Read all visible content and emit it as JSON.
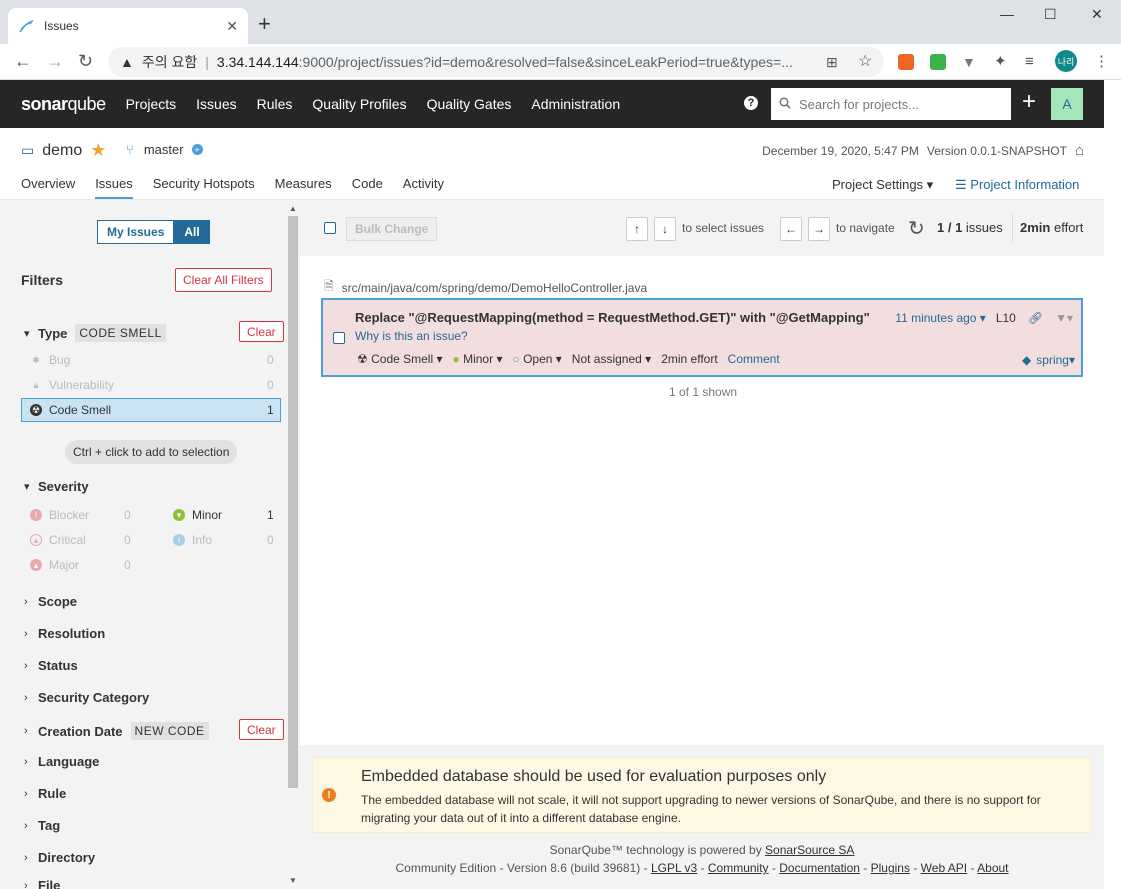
{
  "browser": {
    "tab_title": "Issues",
    "security_label": "주의 요함",
    "url_host": "3.34.144.144",
    "url_path": ":9000/project/issues?id=demo&resolved=false&sinceLeakPeriod=true&types=...",
    "profile_initials": "나리"
  },
  "nav": {
    "logo_bold": "sonar",
    "logo_rest": "qube",
    "links": [
      "Projects",
      "Issues",
      "Rules",
      "Quality Profiles",
      "Quality Gates",
      "Administration"
    ],
    "help": "?",
    "search_placeholder": "Search for projects...",
    "plus": "+",
    "user_initial": "A"
  },
  "project": {
    "name": "demo",
    "branch": "master",
    "date": "December 19, 2020, 5:47 PM",
    "version": "Version 0.0.1-SNAPSHOT",
    "tabs": [
      "Overview",
      "Issues",
      "Security Hotspots",
      "Measures",
      "Code",
      "Activity"
    ],
    "settings": "Project Settings",
    "info": "Project Information"
  },
  "sidebar": {
    "my_issues": "My Issues",
    "all": "All",
    "filters_title": "Filters",
    "clear_all": "Clear All Filters",
    "clear": "Clear",
    "type_label": "Type",
    "type_badge": "CODE SMELL",
    "type_items": [
      {
        "label": "Bug",
        "count": "0"
      },
      {
        "label": "Vulnerability",
        "count": "0"
      },
      {
        "label": "Code Smell",
        "count": "1"
      }
    ],
    "hint": "Ctrl + click to add to selection",
    "severity_label": "Severity",
    "severity_items": [
      {
        "label": "Blocker",
        "count": "0"
      },
      {
        "label": "Minor",
        "count": "1"
      },
      {
        "label": "Critical",
        "count": "0"
      },
      {
        "label": "Info",
        "count": "0"
      },
      {
        "label": "Major",
        "count": "0"
      }
    ],
    "facets": [
      "Scope",
      "Resolution",
      "Status",
      "Security Category",
      "Creation Date",
      "Language",
      "Rule",
      "Tag",
      "Directory",
      "File"
    ],
    "creation_badge": "NEW CODE"
  },
  "toolbar": {
    "bulk_change": "Bulk Change",
    "select_hint": "to select issues",
    "nav_hint": "to navigate",
    "issues_count": "1 / 1",
    "issues_word": "issues",
    "effort_value": "2min",
    "effort_word": "effort"
  },
  "issue": {
    "file": "src/main/java/com/spring/demo/DemoHelloController.java",
    "message": "Replace \"@RequestMapping(method = RequestMethod.GET)\" with \"@GetMapping\"",
    "why": "Why is this an issue?",
    "type": "Code Smell",
    "severity": "Minor",
    "status": "Open",
    "assignee": "Not assigned",
    "effort": "2min effort",
    "comment": "Comment",
    "age": "11 minutes ago",
    "line": "L10",
    "tag": "spring",
    "shown": "1 of 1 shown"
  },
  "alert": {
    "title": "Embedded database should be used for evaluation purposes only",
    "body": "The embedded database will not scale, it will not support upgrading to newer versions of SonarQube, and there is no support for migrating your data out of it into a different database engine."
  },
  "footer": {
    "line1_prefix": "SonarQube™ technology is powered by",
    "line1_link": "SonarSource SA",
    "edition": "Community Edition - Version 8.6 (build 39681) -",
    "links": [
      "LGPL v3",
      "Community",
      "Documentation",
      "Plugins",
      "Web API",
      "About"
    ]
  }
}
